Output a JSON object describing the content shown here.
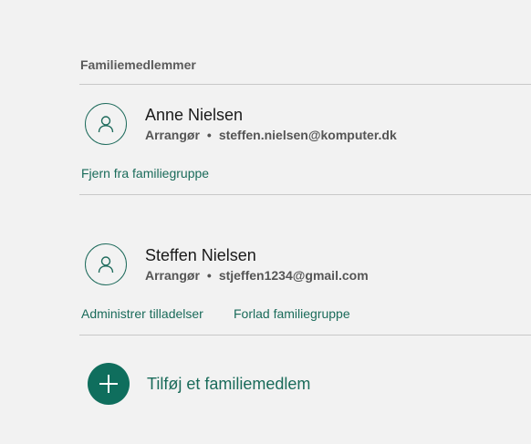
{
  "section": {
    "title": "Familiemedlemmer"
  },
  "members": [
    {
      "name": "Anne Nielsen",
      "role": "Arrangør",
      "separator": "•",
      "email": "steffen.nielsen@komputer.dk",
      "actions": [
        "Fjern fra familiegruppe"
      ]
    },
    {
      "name": "Steffen Nielsen",
      "role": "Arrangør",
      "separator": "•",
      "email": "stjeffen1234@gmail.com",
      "actions": [
        "Administrer tilladelser",
        "Forlad familiegruppe"
      ]
    }
  ],
  "add_member": {
    "label": "Tilføj et familiemedlem",
    "icon": "plus-icon"
  },
  "icons": {
    "avatar": "person-icon"
  },
  "colors": {
    "accent": "#0f6e5d",
    "link": "#1a6b5a",
    "background": "#f2f2f2"
  }
}
